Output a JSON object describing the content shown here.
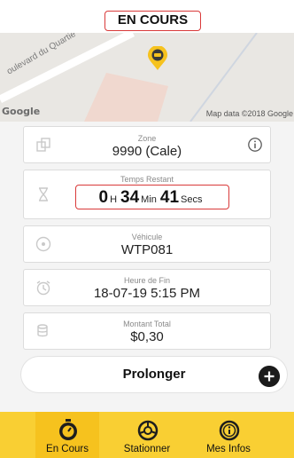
{
  "header": {
    "title": "EN COURS"
  },
  "map": {
    "street_label": "oulevard du Quartie",
    "google_logo": "Google",
    "attribution": "Map data ©2018 Google"
  },
  "zone": {
    "label": "Zone",
    "value": "9990 (Cale)"
  },
  "remaining": {
    "label": "Temps Restant",
    "hours": "0",
    "hours_unit": "H",
    "minutes": "34",
    "minutes_unit": "Min",
    "seconds": "41",
    "seconds_unit": "Secs"
  },
  "vehicle": {
    "label": "Véhicule",
    "value": "WTP081"
  },
  "end_time": {
    "label": "Heure de Fin",
    "value": "18-07-19 5:15 PM"
  },
  "total": {
    "label": "Montant Total",
    "value": "$0,30"
  },
  "extend": {
    "label": "Prolonger"
  },
  "nav": {
    "items": [
      {
        "label": "En Cours"
      },
      {
        "label": "Stationner"
      },
      {
        "label": "Mes Infos"
      }
    ]
  },
  "colors": {
    "accent": "#f9cf33",
    "highlight": "#d93a3a"
  }
}
